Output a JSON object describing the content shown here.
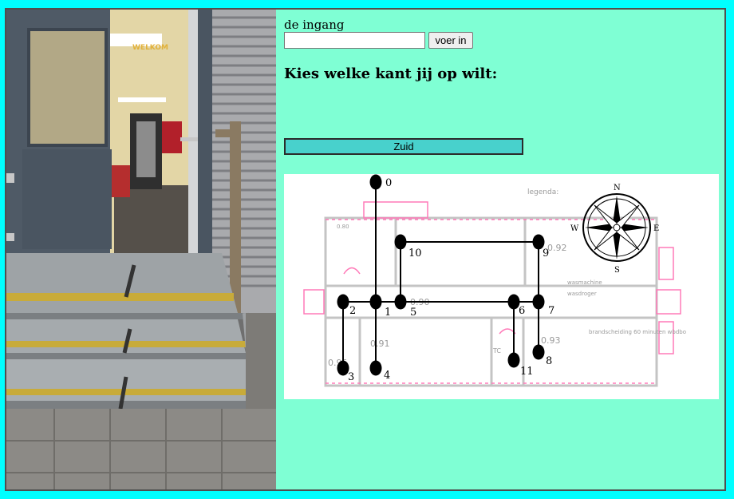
{
  "photo": {
    "alt": "",
    "sign_text": "WELKOM"
  },
  "form": {
    "entrance_label": "de ingang",
    "entrance_value": "",
    "submit_label": "voer in"
  },
  "heading": "Kies welke kant jij op wilt:",
  "direction_button": "Zuid",
  "floorplan": {
    "legend_label": "legenda:",
    "compass": {
      "n": "N",
      "s": "S",
      "e": "E",
      "w": "W"
    },
    "room_labels": [
      "0.80",
      "0.90",
      "0.91",
      "0.92",
      "0.93",
      "0.95"
    ],
    "notes": {
      "laundry1": "wasmachine",
      "laundry2": "wasdroger",
      "fire": "brandscheiding 60 minuten wbdbo",
      "tc": "TC"
    },
    "nodes": [
      {
        "id": "0",
        "label": "0"
      },
      {
        "id": "1",
        "label": "1"
      },
      {
        "id": "2",
        "label": "2"
      },
      {
        "id": "3",
        "label": "3"
      },
      {
        "id": "4",
        "label": "4"
      },
      {
        "id": "5",
        "label": "5"
      },
      {
        "id": "6",
        "label": "6"
      },
      {
        "id": "7",
        "label": "7"
      },
      {
        "id": "8",
        "label": "8"
      },
      {
        "id": "9",
        "label": "9"
      },
      {
        "id": "10",
        "label": "10"
      },
      {
        "id": "11",
        "label": "11"
      }
    ],
    "edges": [
      [
        "0",
        "1"
      ],
      [
        "1",
        "2"
      ],
      [
        "2",
        "3"
      ],
      [
        "1",
        "4"
      ],
      [
        "1",
        "5"
      ],
      [
        "5",
        "10"
      ],
      [
        "10",
        "9"
      ],
      [
        "9",
        "7"
      ],
      [
        "5",
        "6"
      ],
      [
        "6",
        "7"
      ],
      [
        "7",
        "8"
      ],
      [
        "6",
        "11"
      ]
    ]
  }
}
